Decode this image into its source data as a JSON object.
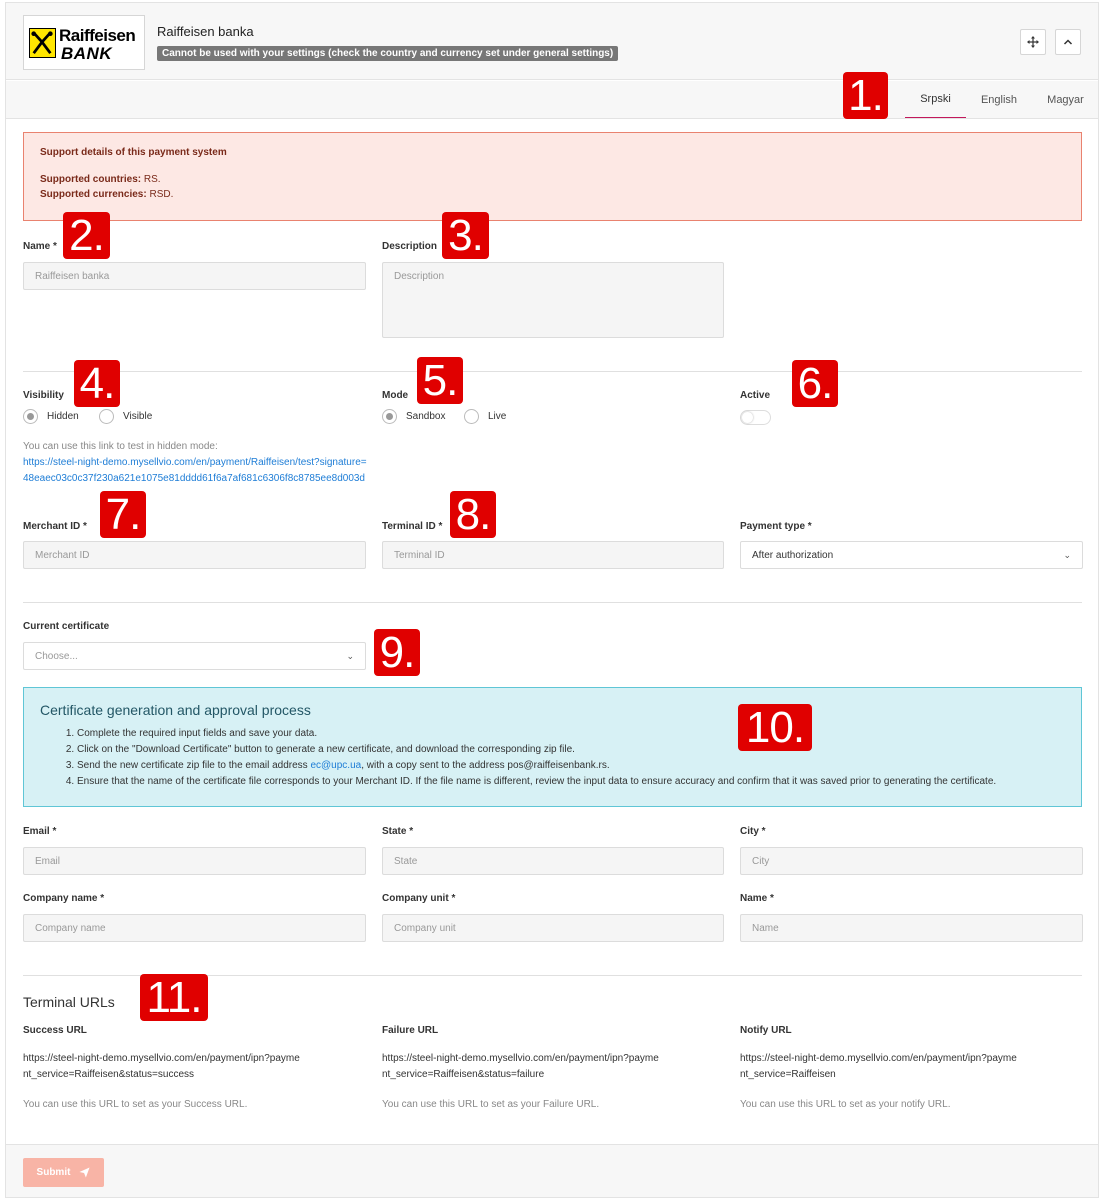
{
  "header": {
    "logo_line1": "Raiffeisen",
    "logo_line2": "BANK",
    "title": "Raiffeisen banka",
    "warning": "Cannot be used with your settings (check the country and currency set under general settings)",
    "move_icon": "move-icon",
    "collapse_icon": "chevron-up-icon"
  },
  "tabs": [
    {
      "label": "Srpski",
      "active": true
    },
    {
      "label": "English",
      "active": false
    },
    {
      "label": "Magyar",
      "active": false
    }
  ],
  "alert": {
    "title": "Support details of this payment system",
    "countries_label": "Supported countries:",
    "countries_value": "RS.",
    "currencies_label": "Supported currencies:",
    "currencies_value": "RSD."
  },
  "name_field": {
    "label": "Name *",
    "value": "Raiffeisen banka"
  },
  "description_field": {
    "label": "Description",
    "placeholder": "Description"
  },
  "visibility": {
    "label": "Visibility",
    "options": [
      "Hidden",
      "Visible"
    ],
    "selected": "Hidden"
  },
  "mode": {
    "label": "Mode",
    "options": [
      "Sandbox",
      "Live"
    ],
    "selected": "Sandbox"
  },
  "active": {
    "label": "Active",
    "on": false
  },
  "test_link": {
    "hint": "You can use this link to test in hidden mode:",
    "url": "https://steel-night-demo.mysellvio.com/en/payment/Raiffeisen/test?signature=48eaec03c0c37f230a621e1075e81dddd61f6a7af681c6306f8c8785ee8d003d"
  },
  "merchant_id": {
    "label": "Merchant ID *",
    "placeholder": "Merchant ID"
  },
  "terminal_id": {
    "label": "Terminal ID *",
    "placeholder": "Terminal ID"
  },
  "payment_type": {
    "label": "Payment type *",
    "value": "After authorization"
  },
  "certificate": {
    "label": "Current certificate",
    "placeholder": "Choose..."
  },
  "cert_process": {
    "title": "Certificate generation and approval process",
    "step1": "Complete the required input fields and save your data.",
    "step2": "Click on the \"Download Certificate\" button to generate a new certificate, and download the corresponding zip file.",
    "step3_a": "Send the new certificate zip file to the email address ",
    "step3_email": "ec@upc.ua",
    "step3_b": ", with a copy sent to the address pos@raiffeisenbank.rs.",
    "step4": "Ensure that the name of the certificate file corresponds to your Merchant ID. If the file name is different, review the input data to ensure accuracy and confirm that it was saved prior to generating the certificate."
  },
  "email": {
    "label": "Email *",
    "placeholder": "Email"
  },
  "state": {
    "label": "State *",
    "placeholder": "State"
  },
  "city": {
    "label": "City *",
    "placeholder": "City"
  },
  "company_name": {
    "label": "Company name *",
    "placeholder": "Company name"
  },
  "company_unit": {
    "label": "Company unit *",
    "placeholder": "Company unit"
  },
  "person_name": {
    "label": "Name *",
    "placeholder": "Name"
  },
  "terminal_urls": {
    "title": "Terminal URLs",
    "success": {
      "label": "Success URL",
      "url": "https://steel-night-demo.mysellvio.com/en/payment/ipn?payment_service=Raiffeisen&status=success",
      "hint": "You can use this URL to set as your Success URL."
    },
    "failure": {
      "label": "Failure URL",
      "url": "https://steel-night-demo.mysellvio.com/en/payment/ipn?payment_service=Raiffeisen&status=failure",
      "hint": "You can use this URL to set as your Failure URL."
    },
    "notify": {
      "label": "Notify URL",
      "url": "https://steel-night-demo.mysellvio.com/en/payment/ipn?payment_service=Raiffeisen",
      "hint": "You can use this URL to set as your notify URL."
    }
  },
  "submit": {
    "label": "Submit",
    "icon": "send-icon"
  },
  "markers": [
    "1.",
    "2.",
    "3.",
    "4.",
    "5.",
    "6.",
    "7.",
    "8.",
    "9.",
    "10.",
    "11."
  ],
  "colors": {
    "accent": "#c2185b",
    "alert_bg": "#fde8e4",
    "info_bg": "#d7f1f5",
    "submit_bg": "#f8b4a6",
    "marker": "#e00000",
    "link": "#1e7dd6"
  }
}
